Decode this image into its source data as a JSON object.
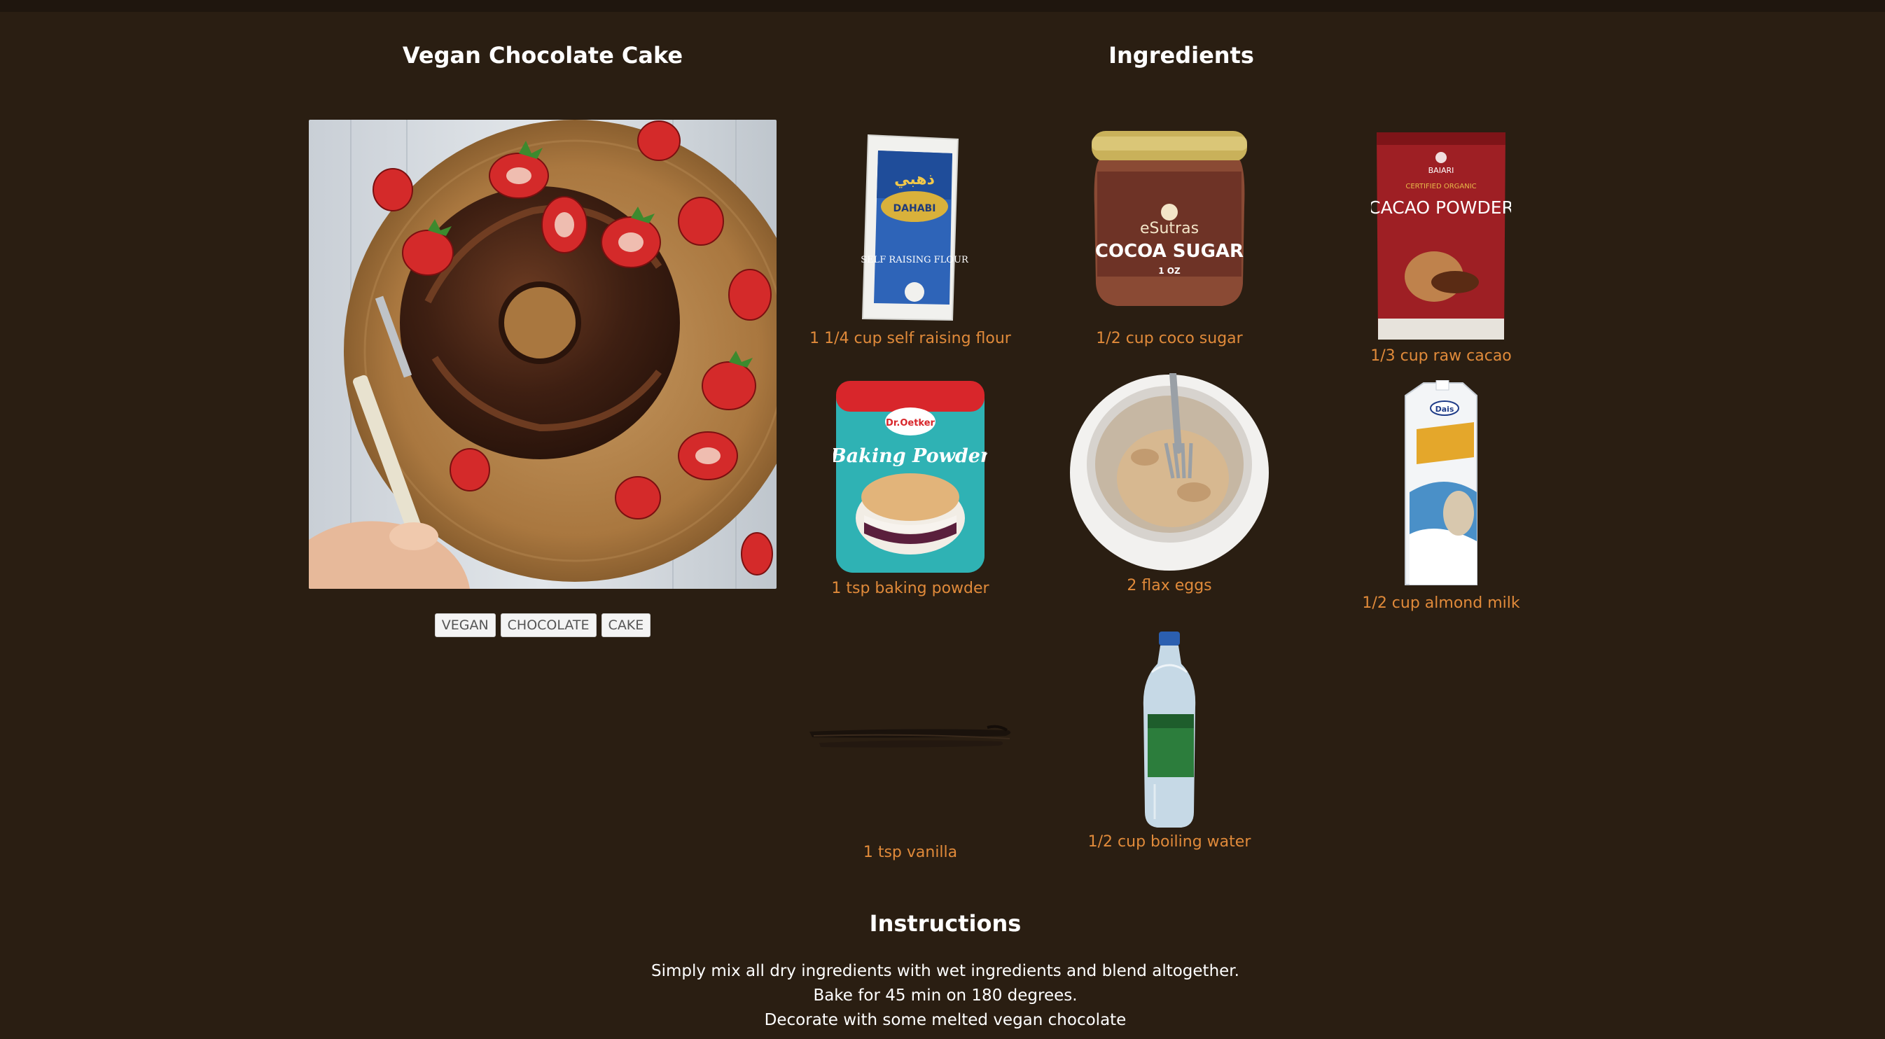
{
  "recipe": {
    "title": "Vegan Chocolate Cake",
    "tags": [
      "VEGAN",
      "CHOCOLATE",
      "CAKE"
    ]
  },
  "ingredients": {
    "title": "Ingredients",
    "items": [
      {
        "label": "1 1/4 cup self raising flour",
        "icon": "flour-bag-icon"
      },
      {
        "label": "1/2 cup coco sugar",
        "icon": "sugar-jar-icon"
      },
      {
        "label": "1/3 cup raw cacao",
        "icon": "cacao-pouch-icon"
      },
      {
        "label": "1 tsp baking powder",
        "icon": "baking-powder-tin-icon"
      },
      {
        "label": "2 flax eggs",
        "icon": "flax-egg-bowl-icon"
      },
      {
        "label": "1/2 cup almond milk",
        "icon": "almond-milk-carton-icon"
      },
      {
        "label": "1 tsp vanilla",
        "icon": "vanilla-pod-icon"
      },
      {
        "label": "1/2 cup boiling water",
        "icon": "water-bottle-icon"
      }
    ],
    "product_text": {
      "flour_brand": "DAHABI",
      "flour_arabic": "ذهبي",
      "flour_name": "SELF RAISING FLOUR",
      "sugar_brand": "eSutras",
      "sugar_name": "COCOA SUGAR",
      "sugar_size": "1 OZ",
      "cacao_brand": "BAIARI",
      "cacao_note": "CERTIFIED ORGANIC",
      "cacao_name": "CACAO POWDER",
      "bp_brand": "Dr.Oetker",
      "bp_name": "Baking Powder",
      "milk_brand": "Dais"
    }
  },
  "instructions": {
    "title": "Instructions",
    "lines": [
      "Simply mix all dry ingredients with wet ingredients and blend altogether.",
      "Bake for 45 min on 180 degrees.",
      "Decorate with some melted vegan chocolate"
    ]
  },
  "colors": {
    "background": "#2a1e12",
    "ingredient_label": "#e08a3a",
    "heading": "#ffffff"
  }
}
